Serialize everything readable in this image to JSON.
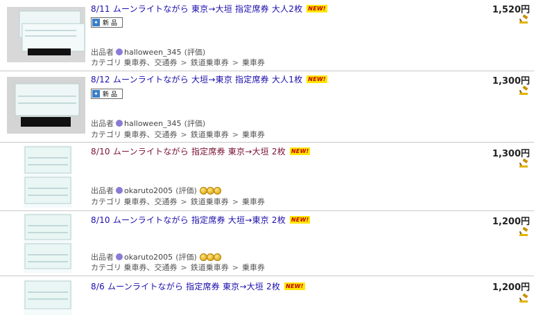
{
  "new_badge": "NEW!",
  "seller_label": "出品者",
  "category_label": "カテゴリ",
  "listings": [
    {
      "title": "8/11 ムーンライトながら 東京→大垣 指定席券 大人2枚",
      "price": "1,520円",
      "condition": "新品",
      "seller_name": "halloween_345",
      "seller_rating": "(評価)",
      "category_path": [
        "乗車券、交通券",
        "鉄道乗車券",
        "乗車券"
      ]
    },
    {
      "title": "8/12 ムーンライトながら 大垣→東京 指定席券 大人1枚",
      "price": "1,300円",
      "condition": "新品",
      "seller_name": "halloween_345",
      "seller_rating": "(評価)",
      "category_path": [
        "乗車券、交通券",
        "鉄道乗車券",
        "乗車券"
      ]
    },
    {
      "title": "8/10 ムーンライトながら 指定席券 東京→大垣 2枚",
      "price": "1,300円",
      "seller_name": "okaruto2005",
      "seller_rating": "(評価)",
      "category_path": [
        "乗車券、交通券",
        "鉄道乗車券",
        "乗車券"
      ]
    },
    {
      "title": "8/10 ムーンライトながら 指定席券 大垣→東京 2枚",
      "price": "1,200円",
      "seller_name": "okaruto2005",
      "seller_rating": "(評価)",
      "category_path": [
        "乗車券、交通券",
        "鉄道乗車券",
        "乗車券"
      ]
    },
    {
      "title": "8/6 ムーンライトながら 指定席券 東京→大垣 2枚",
      "price": "1,200円"
    }
  ]
}
